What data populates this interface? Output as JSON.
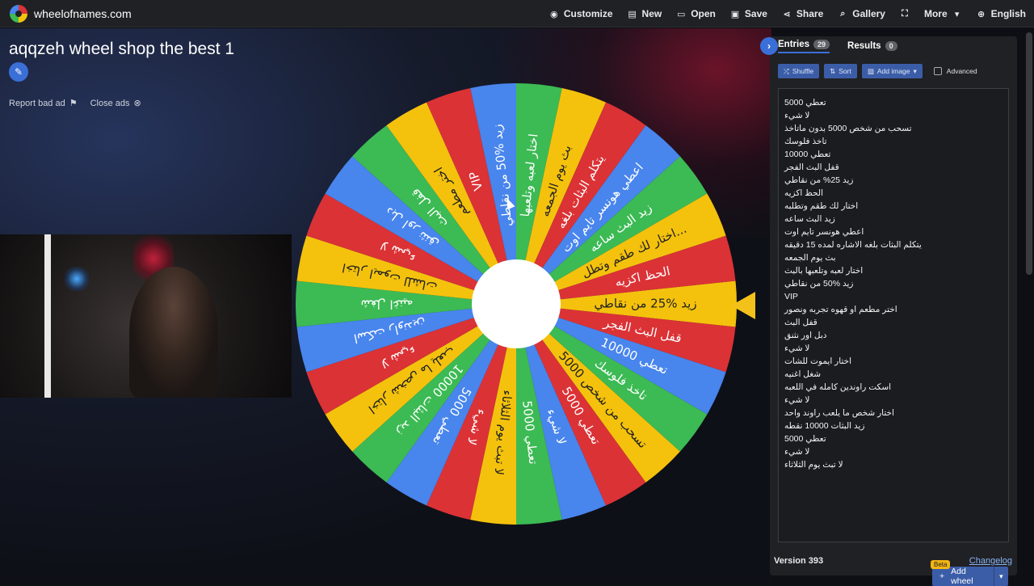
{
  "app": {
    "site_name": "wheelofnames.com"
  },
  "nav": {
    "customize": "Customize",
    "new": "New",
    "open": "Open",
    "save": "Save",
    "share": "Share",
    "gallery": "Gallery",
    "more": "More",
    "language": "English"
  },
  "wheel": {
    "title": "aqqzeh wheel shop the best 1",
    "report_bad_ad": "Report bad ad",
    "close_ads": "Close ads",
    "segments": [
      {
        "label": "زيد %25 من نقاطي",
        "color": "#f4c20d"
      },
      {
        "label": "قفل البث الفجر",
        "color": "#db3236"
      },
      {
        "label": "تعطي 10000",
        "color": "#4885ed"
      },
      {
        "label": "تاخذ فلوسك",
        "color": "#3cba54"
      },
      {
        "label": "تسحب من شخص 5000",
        "color": "#f4c20d"
      },
      {
        "label": "تعطي 5000",
        "color": "#db3236"
      },
      {
        "label": "لا شيء",
        "color": "#4885ed"
      },
      {
        "label": "تعطي 5000",
        "color": "#3cba54"
      },
      {
        "label": "لا تبث يوم الثلاثاء",
        "color": "#f4c20d"
      },
      {
        "label": "لا شيء",
        "color": "#db3236"
      },
      {
        "label": "تعطي 5000",
        "color": "#4885ed"
      },
      {
        "label": "زيد البثات 10000",
        "color": "#3cba54"
      },
      {
        "label": "اختار شخص ما يلعب",
        "color": "#f4c20d"
      },
      {
        "label": "لا شيء",
        "color": "#db3236"
      },
      {
        "label": "اسكت راوندين",
        "color": "#4885ed"
      },
      {
        "label": "شغل اغنيه",
        "color": "#3cba54"
      },
      {
        "label": "اختار ايموت للشات",
        "color": "#f4c20d"
      },
      {
        "label": "لا شيء",
        "color": "#db3236"
      },
      {
        "label": "دبل اور نثنق",
        "color": "#4885ed"
      },
      {
        "label": "قفل البث",
        "color": "#3cba54"
      },
      {
        "label": "اختر مطعم",
        "color": "#f4c20d"
      },
      {
        "label": "VIP",
        "color": "#db3236"
      },
      {
        "label": "زيد %50 من نقاطي",
        "color": "#4885ed"
      },
      {
        "label": "اختار لعبه وتلعبها",
        "color": "#3cba54"
      },
      {
        "label": "بث يوم الجمعه",
        "color": "#f4c20d"
      },
      {
        "label": "يتكلم البثات بلغه",
        "color": "#db3236"
      },
      {
        "label": "اعطي هونسر تايم اوت",
        "color": "#4885ed"
      },
      {
        "label": "زيد البث ساعه",
        "color": "#3cba54"
      },
      {
        "label": "اختار لك طقم وتطل...",
        "color": "#f4c20d"
      },
      {
        "label": "الحظ اكزيه",
        "color": "#db3236"
      }
    ]
  },
  "panel": {
    "tab_entries": "Entries",
    "entries_count": "29",
    "tab_results": "Results",
    "results_count": "0",
    "shuffle": "Shuffle",
    "sort": "Sort",
    "add_image": "Add image",
    "advanced": "Advanced",
    "entries": [
      "تعطي 5000",
      "لا شيء",
      "تسحب من شخص 5000 بدون ماتاخذ",
      "تاخذ فلوسك",
      "تعطي 10000",
      "قفل البث الفجر",
      "زيد 25% من نقاطي",
      "الحظ اكزيه",
      "اختار لك طقم وتطلبه",
      "زيد البث ساعه",
      "اعطي هونسر تايم اوت",
      "يتكلم البثات بلغه الاشاره لمده 15 دقيقه",
      "بث يوم الجمعه",
      "اختار لعبه وتلعبها بالبث",
      "زيد %50 من نقاطي",
      "VIP",
      "اختر مطعم او قهوه تجربه ونصور",
      "قفل البث",
      "دبل اور نثنق",
      "لا شيء",
      "اختار ايموت للشات",
      "شغل اغنيه",
      "اسكت راوندين كامله في اللعبه",
      "لا شيء",
      "اختار شخص ما يلعب راوند واحد",
      "زيد البثات 10000 نقطه",
      "تعطي 5000",
      "لا شيء",
      "لا تبث يوم الثلاثاء"
    ],
    "beta": "Beta",
    "add_wheel": "Add wheel",
    "version": "Version 393",
    "changelog": "Changelog"
  }
}
